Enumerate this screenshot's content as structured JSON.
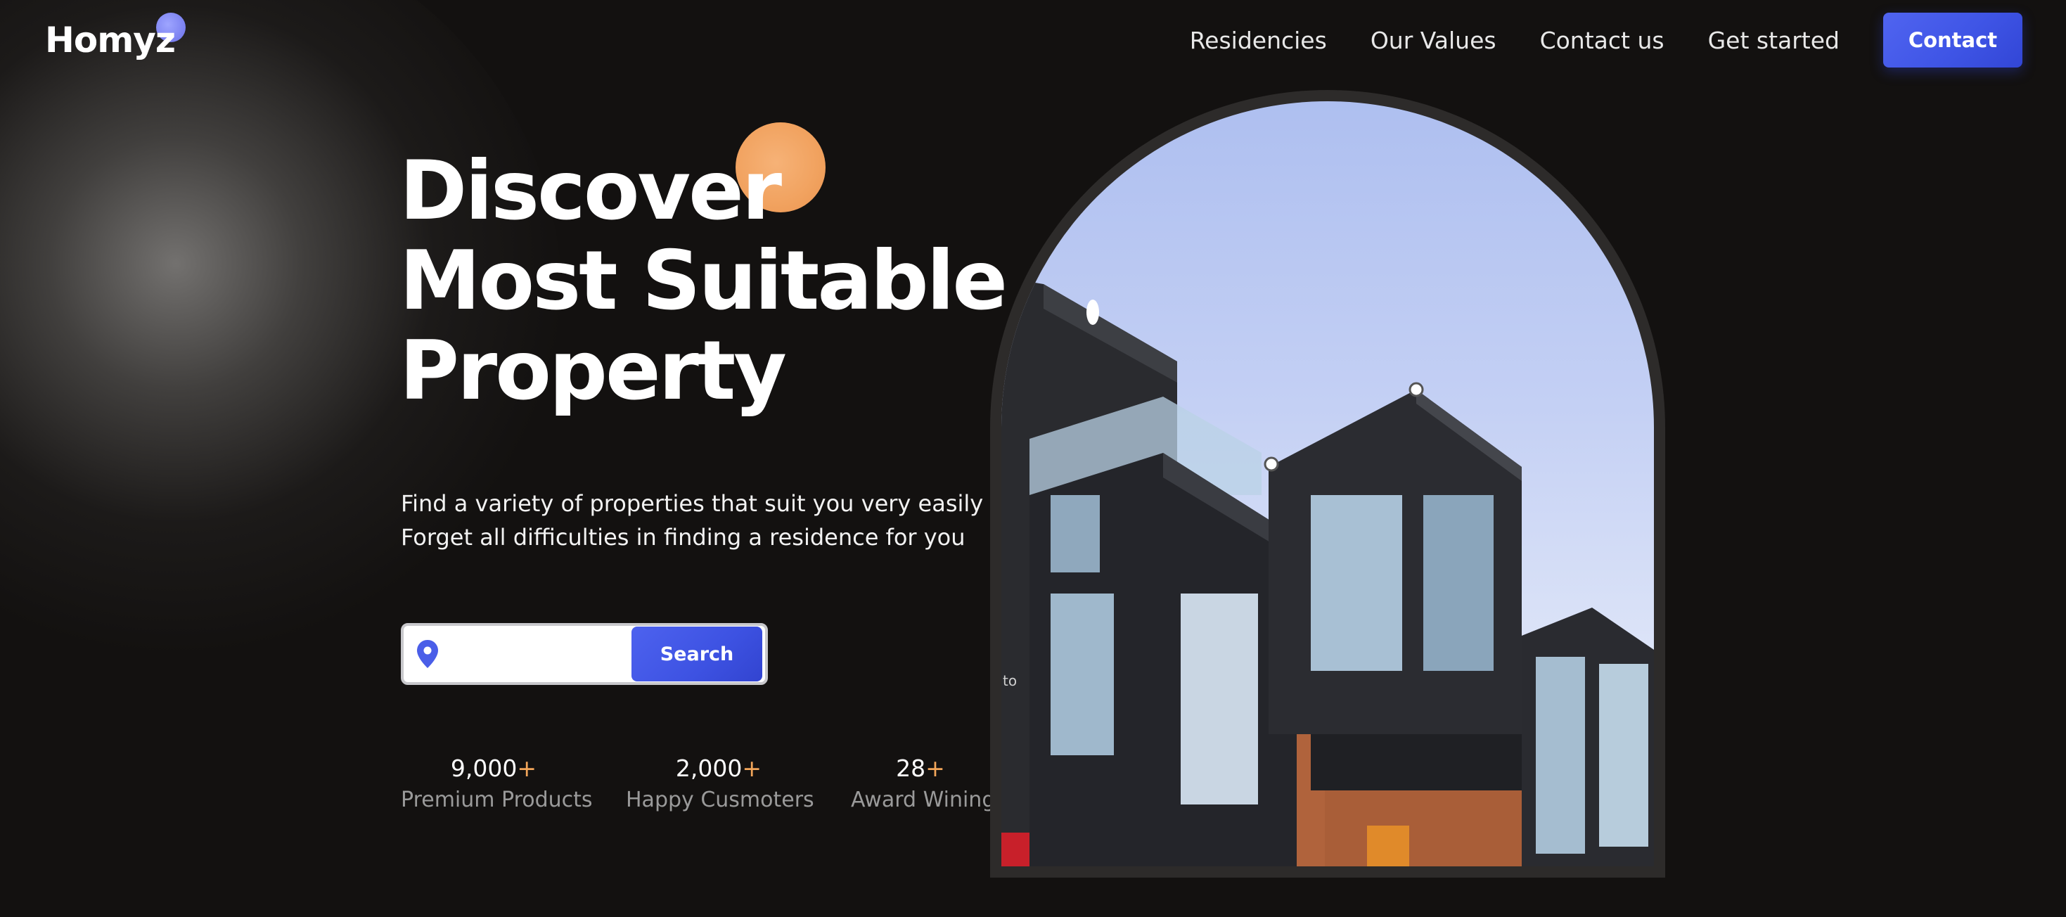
{
  "header": {
    "logo": "Homyz",
    "nav": [
      "Residencies",
      "Our Values",
      "Contact us",
      "Get started"
    ],
    "contact_label": "Contact"
  },
  "hero": {
    "headline": [
      "Discover",
      "Most Suitable",
      "Property"
    ],
    "subtext": [
      "Find a variety of properties that suit you very easily",
      "Forget all difficulties in finding a residence for you"
    ],
    "search": {
      "value": "",
      "button_label": "Search",
      "pin_icon": "location-pin-icon"
    },
    "stats": [
      {
        "number": "9,000",
        "suffix": "+",
        "label": "Premium Products"
      },
      {
        "number": "2,000",
        "suffix": "+",
        "label": "Happy Cusmoters"
      },
      {
        "number": "28",
        "suffix": "+",
        "label": "Award Wining"
      }
    ],
    "image_caption_fragment": "to"
  },
  "colors": {
    "background": "#131110",
    "accent_blue": "#4060ee",
    "accent_orange": "#f2a65a",
    "logo_dot": "#8a90f5"
  }
}
